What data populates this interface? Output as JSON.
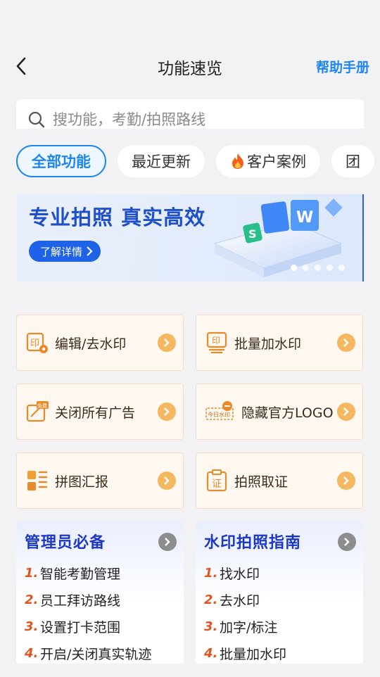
{
  "header": {
    "title": "功能速览",
    "help_label": "帮助手册"
  },
  "search": {
    "placeholder": "搜功能，考勤/拍照路线"
  },
  "tabs": [
    {
      "label": "全部功能",
      "active": true
    },
    {
      "label": "最近更新",
      "active": false
    },
    {
      "label": "客户案例",
      "active": false,
      "icon": "fire-icon"
    },
    {
      "label": "团",
      "active": false
    }
  ],
  "banner": {
    "title": "专业拍照 真实高效",
    "button_label": "了解详情",
    "slide_count": 5,
    "current_slide": 1
  },
  "features": [
    {
      "label": "编辑/去水印",
      "icon": "edit-watermark-icon"
    },
    {
      "label": "批量加水印",
      "icon": "batch-watermark-icon"
    },
    {
      "label": "关闭所有广告",
      "icon": "ad-free-icon",
      "icon_text": "免费"
    },
    {
      "label": "隐藏官方LOGO",
      "icon": "hide-logo-icon",
      "icon_text": "今日水印"
    },
    {
      "label": "拼图汇报",
      "icon": "puzzle-report-icon"
    },
    {
      "label": "拍照取证",
      "icon": "evidence-icon",
      "icon_text": "证"
    }
  ],
  "guides": [
    {
      "title": "管理员必备",
      "items": [
        "智能考勤管理",
        "员工拜访路线",
        "设置打卡范围",
        "开启/关闭真实轨迹"
      ]
    },
    {
      "title": "水印拍照指南",
      "items": [
        "找水印",
        "去水印",
        "加字/标注",
        "批量加水印"
      ]
    }
  ],
  "colors": {
    "accent": "#1e86f2",
    "card_bg": "#fff8f0",
    "card_border": "#f8dcc2",
    "arrow_orange": "#f4b860",
    "guide_title": "#1c38c9",
    "number": "#e2541f"
  }
}
